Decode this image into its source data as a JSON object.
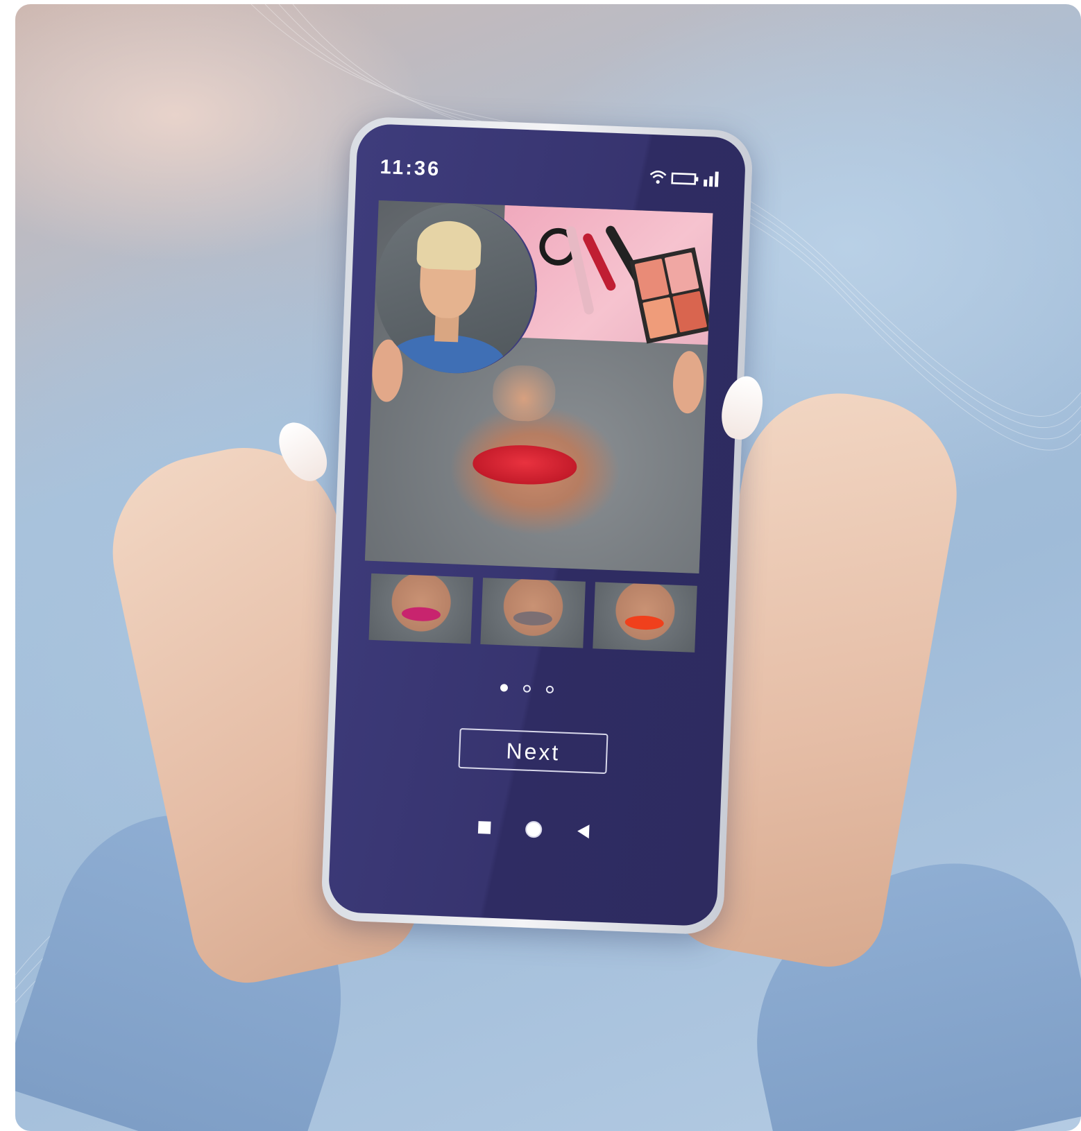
{
  "status_bar": {
    "time": "11:36",
    "icons": [
      "wifi-icon",
      "battery-icon",
      "signal-icon"
    ]
  },
  "hero": {
    "lip_color": "#d7232f"
  },
  "lipstick_options": [
    {
      "name": "magenta",
      "color": "#c8246e"
    },
    {
      "name": "taupe",
      "color": "#7c6f73"
    },
    {
      "name": "orange-red",
      "color": "#f0401c"
    }
  ],
  "pagination": {
    "total": 3,
    "active": 1
  },
  "next_button": {
    "label": "Next"
  },
  "nav_bar": {
    "buttons": [
      "recents-icon",
      "home-icon",
      "back-icon"
    ]
  },
  "colors": {
    "screen": "#3e3c7c",
    "accent_white": "#ffffff"
  }
}
